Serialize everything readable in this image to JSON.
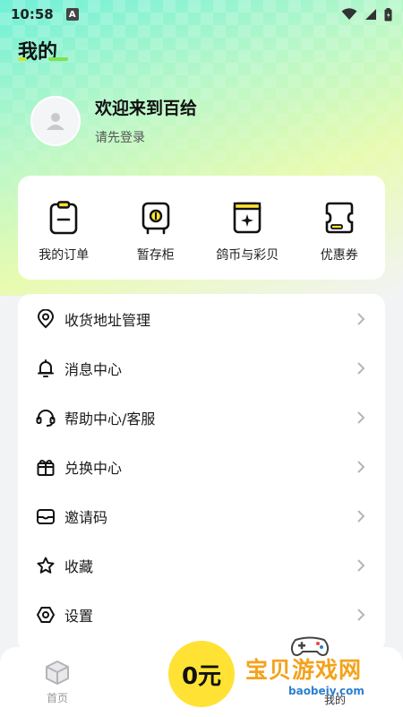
{
  "status_bar": {
    "time": "10:58",
    "notification_icon": "A"
  },
  "page": {
    "title": "我的"
  },
  "profile": {
    "welcome": "欢迎来到百给",
    "login_hint": "请先登录"
  },
  "quick_actions": [
    {
      "label": "我的订单",
      "icon": "clipboard-icon"
    },
    {
      "label": "暂存柜",
      "icon": "locker-icon"
    },
    {
      "label": "鸽币与彩贝",
      "icon": "coin-book-icon"
    },
    {
      "label": "优惠券",
      "icon": "coupon-icon"
    }
  ],
  "menu": [
    {
      "label": "收货地址管理",
      "icon": "location-pin-icon"
    },
    {
      "label": "消息中心",
      "icon": "bell-icon"
    },
    {
      "label": "帮助中心/客服",
      "icon": "headset-icon"
    },
    {
      "label": "兑换中心",
      "icon": "gift-box-icon"
    },
    {
      "label": "邀请码",
      "icon": "envelope-icon"
    },
    {
      "label": "收藏",
      "icon": "star-icon"
    },
    {
      "label": "设置",
      "icon": "settings-hexagon-icon"
    }
  ],
  "bottom_nav": {
    "home_label": "首页",
    "mine_label": "我的",
    "price_badge": "0元"
  },
  "watermark": {
    "text": "宝贝游戏网",
    "url": "baobeiy.com"
  },
  "colors": {
    "accent": "#a8f06a",
    "badge": "#ffe234",
    "watermark": "#f4a21c"
  }
}
